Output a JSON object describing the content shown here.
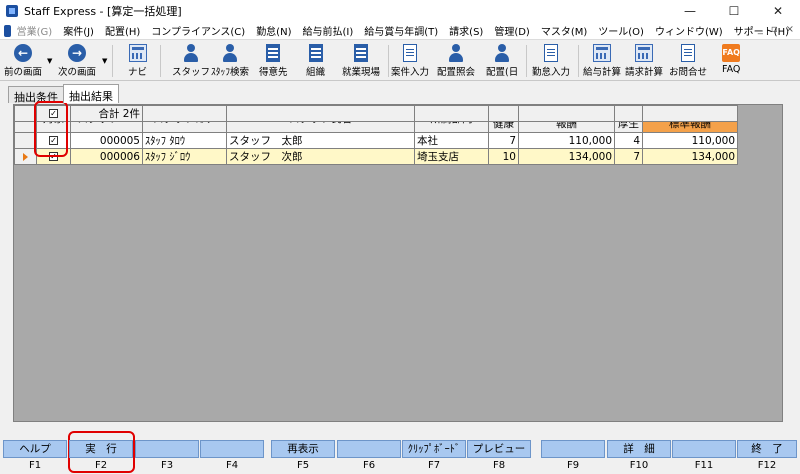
{
  "window": {
    "title": "Staff Express - [算定一括処理]",
    "minimize": "—",
    "maximize": "☐",
    "close": "✕"
  },
  "menu": [
    "営業(G)",
    "案件(J)",
    "配置(H)",
    "コンプライアンス(C)",
    "勤怠(N)",
    "給与前払(I)",
    "給与賞与年調(T)",
    "請求(S)",
    "管理(D)",
    "マスタ(M)",
    "ツール(O)",
    "ウィンドウ(W)",
    "サポート(H)"
  ],
  "mdi_controls": [
    "_",
    "▫",
    "×"
  ],
  "toolbar": {
    "back": "前の画面",
    "next": "次の画面",
    "navi": "ナビ",
    "staff": "スタッフ",
    "staff_search": "ｽﾀｯﾌ検索",
    "client": "得意先",
    "org": "組織",
    "worksite": "就業現場",
    "case_entry": "案件入力",
    "assign_inquiry": "配置照会",
    "assign_day": "配置(日",
    "attendance_entry": "勤怠入力",
    "payroll_calc": "給与計算",
    "billing_calc": "請求計算",
    "contact": "お問合せ",
    "faq": "FAQ",
    "faq_icon_text": "FAQ"
  },
  "tabs": [
    "抽出条件",
    "抽出結果"
  ],
  "grid": {
    "headers": {
      "target": "対象",
      "staff_no": "スタッフNO",
      "staff_kana": "スタッフカナ",
      "staff_name": "スタッフ氏名",
      "dept": "所属部門",
      "health_now": "現在健康",
      "health_std": "現在健康保険標準報酬",
      "pension_now": "現在厚生",
      "pension_std": "現在厚生年金保険標準報酬"
    },
    "rows": [
      {
        "checked": "✓",
        "staff_no": "000005",
        "kana": "ｽﾀｯﾌ ﾀﾛｳ",
        "name": "スタッフ　太郎",
        "dept": "本社",
        "health_now": "7",
        "health_std": "110,000",
        "pension_now": "4",
        "pension_std": "110,000"
      },
      {
        "checked": "✓",
        "staff_no": "000006",
        "kana": "ｽﾀｯﾌ ｼﾞﾛｳ",
        "name": "スタッフ　次郎",
        "dept": "埼玉支店",
        "health_now": "10",
        "health_std": "134,000",
        "pension_now": "7",
        "pension_std": "134,000"
      }
    ],
    "footer": {
      "checked": "✓",
      "total": "合計 2件"
    }
  },
  "fkeys": [
    {
      "label": "ヘルプ",
      "key": "F1"
    },
    {
      "label": "実　行",
      "key": "F2"
    },
    {
      "label": "",
      "key": "F3"
    },
    {
      "label": "",
      "key": "F4"
    },
    {
      "label": "再表示",
      "key": "F5"
    },
    {
      "label": "",
      "key": "F6"
    },
    {
      "label": "ｸﾘｯﾌﾟﾎﾞｰﾄﾞ",
      "key": "F7"
    },
    {
      "label": "プレビュー",
      "key": "F8"
    },
    {
      "label": "",
      "key": "F9"
    },
    {
      "label": "詳　細",
      "key": "F10"
    },
    {
      "label": "",
      "key": "F11"
    },
    {
      "label": "終　了",
      "key": "F12"
    }
  ],
  "colors": {
    "highlight": "#e00000",
    "selected_row": "#fff8c8",
    "orange_header": "#f4a14a",
    "fkey": "#a8c8f0"
  }
}
